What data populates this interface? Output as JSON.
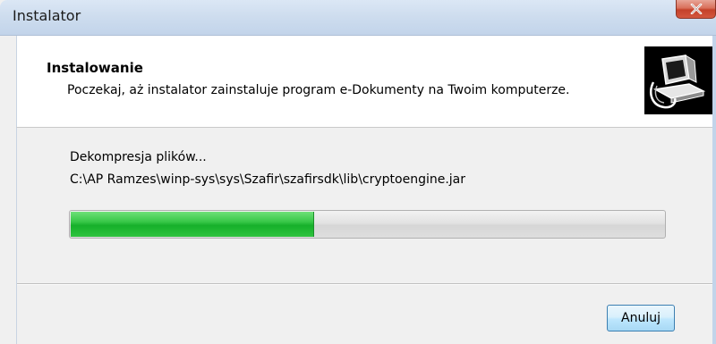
{
  "window": {
    "title": "Instalator"
  },
  "header": {
    "title": "Instalowanie",
    "subtitle": "Poczekaj, aż instalator zainstaluje program e-Dokumenty na Twoim komputerze.",
    "logo_icon": "installer-computer-icon"
  },
  "body": {
    "status": "Dekompresja plików...",
    "current_file": "C:\\AP Ramzes\\winp-sys\\sys\\Szafir\\szafirsdk\\lib\\cryptoengine.jar",
    "progress_percent": 41
  },
  "buttons": {
    "cancel": "Anuluj",
    "close_icon": "close-icon"
  },
  "colors": {
    "progress_fill": "#22b834",
    "close_button": "#c4412a",
    "titlebar": "#cddcee"
  }
}
